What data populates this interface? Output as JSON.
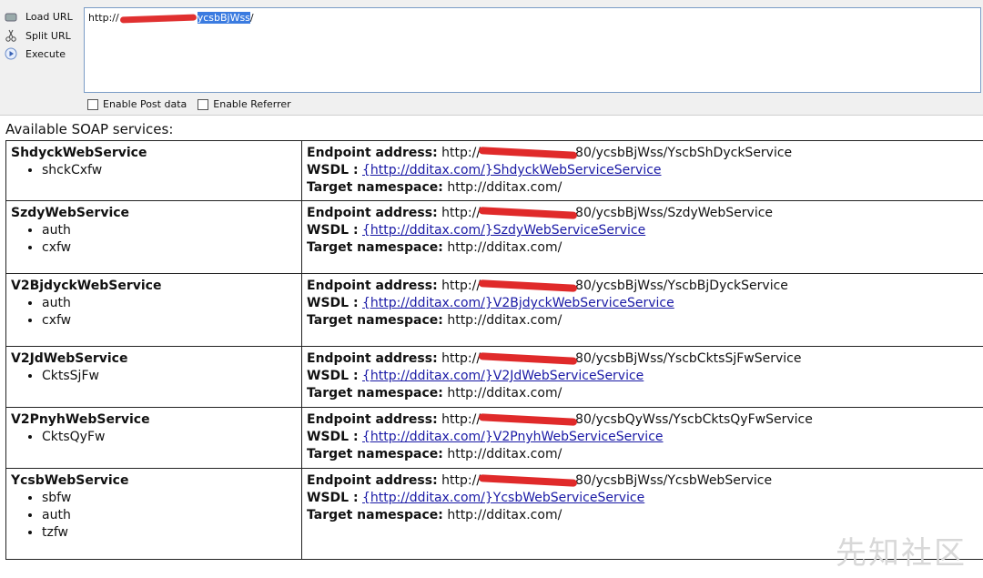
{
  "toolbar": {
    "load_url": "Load URL",
    "split_url": "Split URL",
    "execute": "Execute",
    "url_prefix": "http://",
    "url_selected": "ycsbBjWss",
    "url_suffix": "/",
    "enable_post": "Enable Post data",
    "enable_referrer": "Enable Referrer"
  },
  "heading": "Available SOAP services:",
  "labels": {
    "endpoint": "Endpoint address:",
    "wsdl": "WSDL :",
    "namespace": "Target namespace:"
  },
  "services": [
    {
      "name": "ShdyckWebService",
      "ops": [
        "shckCxfw"
      ],
      "endpoint_prefix": "http://",
      "endpoint_suffix": "80/ycsbBjWss/YscbShDyckService",
      "wsdl": "{http://dditax.com/}ShdyckWebServiceService",
      "namespace": "http://dditax.com/"
    },
    {
      "name": "SzdyWebService",
      "ops": [
        "auth",
        "cxfw"
      ],
      "endpoint_prefix": "http://",
      "endpoint_suffix": "80/ycsbBjWss/SzdyWebService",
      "wsdl": "{http://dditax.com/}SzdyWebServiceService",
      "namespace": "http://dditax.com/"
    },
    {
      "name": "V2BjdyckWebService",
      "ops": [
        "auth",
        "cxfw"
      ],
      "endpoint_prefix": "http://",
      "endpoint_suffix": "80/ycsbBjWss/YscbBjDyckService",
      "wsdl": "{http://dditax.com/}V2BjdyckWebServiceService",
      "namespace": "http://dditax.com/"
    },
    {
      "name": "V2JdWebService",
      "ops": [
        "CktsSjFw"
      ],
      "endpoint_prefix": "http://",
      "endpoint_suffix": "80/ycsbBjWss/YscbCktsSjFwService",
      "wsdl": "{http://dditax.com/}V2JdWebServiceService",
      "namespace": "http://dditax.com/"
    },
    {
      "name": "V2PnyhWebService",
      "ops": [
        "CktsQyFw"
      ],
      "endpoint_prefix": "http://",
      "endpoint_suffix": "80/ycsbQyWss/YscbCktsQyFwService",
      "wsdl": "{http://dditax.com/}V2PnyhWebServiceService",
      "namespace": "http://dditax.com/"
    },
    {
      "name": "YcsbWebService",
      "ops": [
        "sbfw",
        "auth",
        "tzfw"
      ],
      "endpoint_prefix": "http://",
      "endpoint_suffix": "80/ycsbBjWss/YcsbWebService",
      "wsdl": "{http://dditax.com/}YcsbWebServiceService",
      "namespace": "http://dditax.com/"
    }
  ],
  "watermark": "先知社区",
  "colors": {
    "link": "#1a1aa6",
    "selection": "#3b7be0",
    "redaction": "#e03030"
  }
}
